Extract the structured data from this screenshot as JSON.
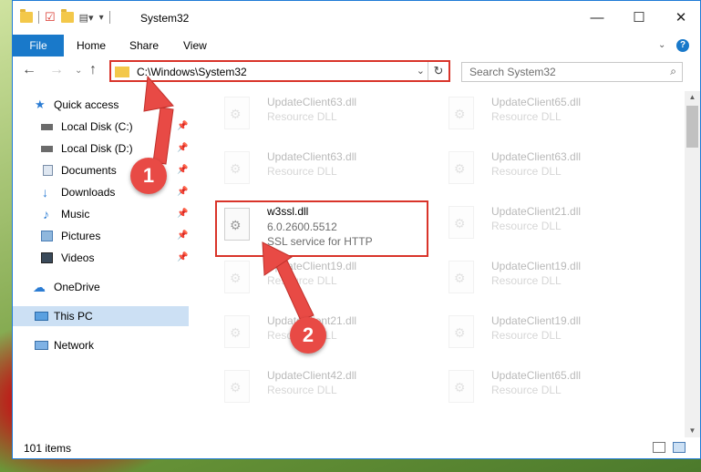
{
  "window": {
    "title": "System32"
  },
  "ribbon": {
    "tabs": [
      "File",
      "Home",
      "Share",
      "View"
    ]
  },
  "address": {
    "path": "C:\\Windows\\System32"
  },
  "search": {
    "placeholder": "Search System32"
  },
  "sidebar": {
    "items": [
      {
        "label": "Quick access",
        "icon": "star-icon",
        "pinned": false
      },
      {
        "label": "Local Disk (C:)",
        "icon": "drive-icon",
        "pinned": true
      },
      {
        "label": "Local Disk (D:)",
        "icon": "drive-icon",
        "pinned": true
      },
      {
        "label": "Documents",
        "icon": "documents-icon",
        "pinned": true
      },
      {
        "label": "Downloads",
        "icon": "download-icon",
        "pinned": true
      },
      {
        "label": "Music",
        "icon": "music-icon",
        "pinned": true
      },
      {
        "label": "Pictures",
        "icon": "pictures-icon",
        "pinned": true
      },
      {
        "label": "Videos",
        "icon": "videos-icon",
        "pinned": true
      },
      {
        "label": "OneDrive",
        "icon": "cloud-icon",
        "pinned": false
      },
      {
        "label": "This PC",
        "icon": "computer-icon",
        "pinned": false,
        "selected": true
      },
      {
        "label": "Network",
        "icon": "network-icon",
        "pinned": false
      }
    ]
  },
  "files": [
    {
      "name": "UpdateClient63.dll",
      "type": "Resource DLL"
    },
    {
      "name": "UpdateClient65.dll",
      "type": "Resource DLL"
    },
    {
      "name": "UpdateClient63.dll",
      "type": "Resource DLL"
    },
    {
      "name": "UpdateClient63.dll",
      "type": "Resource DLL"
    },
    {
      "name": "w3ssl.dll",
      "version": "6.0.2600.5512",
      "description": "SSL service for HTTP",
      "highlighted": true
    },
    {
      "name": "UpdateClient21.dll",
      "type": "Resource DLL"
    },
    {
      "name": "UpdateClient19.dll",
      "type": "Resource DLL"
    },
    {
      "name": "UpdateClient19.dll",
      "type": "Resource DLL"
    },
    {
      "name": "UpdateClient21.dll",
      "type": "Resource DLL"
    },
    {
      "name": "UpdateClient19.dll",
      "type": "Resource DLL"
    },
    {
      "name": "UpdateClient42.dll",
      "type": "Resource DLL"
    },
    {
      "name": "UpdateClient65.dll",
      "type": "Resource DLL"
    }
  ],
  "status": {
    "item_count": "101 items"
  },
  "markers": [
    "1",
    "2"
  ],
  "colors": {
    "accent": "#1979ca",
    "highlight": "#d9342a",
    "selected": "#cce0f4"
  }
}
